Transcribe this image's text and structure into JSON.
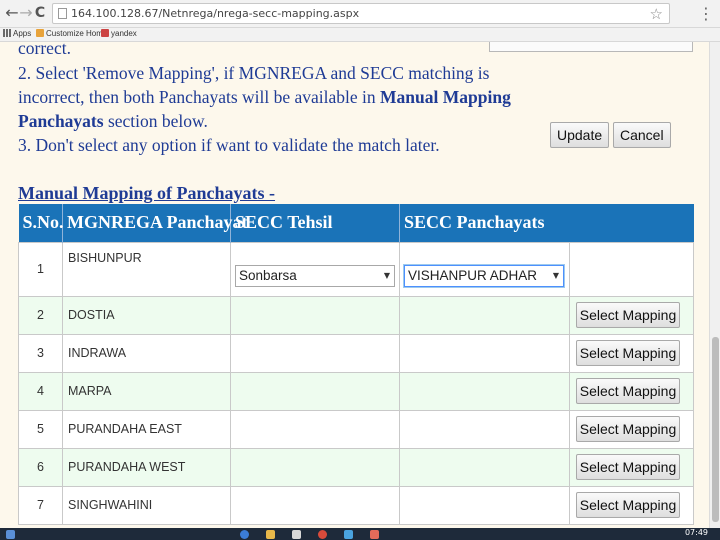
{
  "browser": {
    "back_icon": "←",
    "forward_icon": "→",
    "reload_icon": "C",
    "url": "164.100.128.67/Netnrega/nrega-secc-mapping.aspx",
    "star_icon": "☆",
    "menu_icon": "⋮"
  },
  "bookmarks": [
    {
      "label": "Apps",
      "icon": "apps-icon"
    },
    {
      "label": "Customize Home",
      "icon": "bookmark-icon"
    },
    {
      "label": "yandex",
      "icon": "bookmark-icon"
    }
  ],
  "instructions": {
    "line0": "correct.",
    "line1": "2. Select 'Remove Mapping', if MGNREGA and SECC matching is",
    "line2_a": "incorrect, then both Panchayats will be available in ",
    "line2_b": "Manual Mapping",
    "line3_a": "Panchayats",
    "line3_b": " section below.",
    "line4": "3. Don't select any option if want to validate the match later."
  },
  "section_title": "Manual Mapping of Panchayats -",
  "table": {
    "headers": [
      "S.No.",
      "MGNREGA Panchayat",
      "SECC Tehsil",
      "SECC Panchayats"
    ],
    "rows": [
      {
        "sno": "1",
        "name": "BISHUNPUR",
        "tehsil": "Sonbarsa",
        "panchayat": "VISHANPUR ADHAR",
        "update": "Update",
        "cancel": "Cancel"
      },
      {
        "sno": "2",
        "name": "DOSTIA",
        "action": "Select Mapping"
      },
      {
        "sno": "3",
        "name": "INDRAWA",
        "action": "Select Mapping"
      },
      {
        "sno": "4",
        "name": "MARPA",
        "action": "Select Mapping"
      },
      {
        "sno": "5",
        "name": "PURANDAHA EAST",
        "action": "Select Mapping"
      },
      {
        "sno": "6",
        "name": "PURANDAHA WEST",
        "action": "Select Mapping"
      },
      {
        "sno": "7",
        "name": "SINGHWAHINI",
        "action": "Select Mapping"
      }
    ]
  },
  "taskbar": {
    "clock": "07:49"
  },
  "colors": {
    "header_bg": "#1a73b8",
    "text_blue": "#1f3b95",
    "page_bg": "#fdf8ec",
    "row_alt": "#eefcef"
  }
}
